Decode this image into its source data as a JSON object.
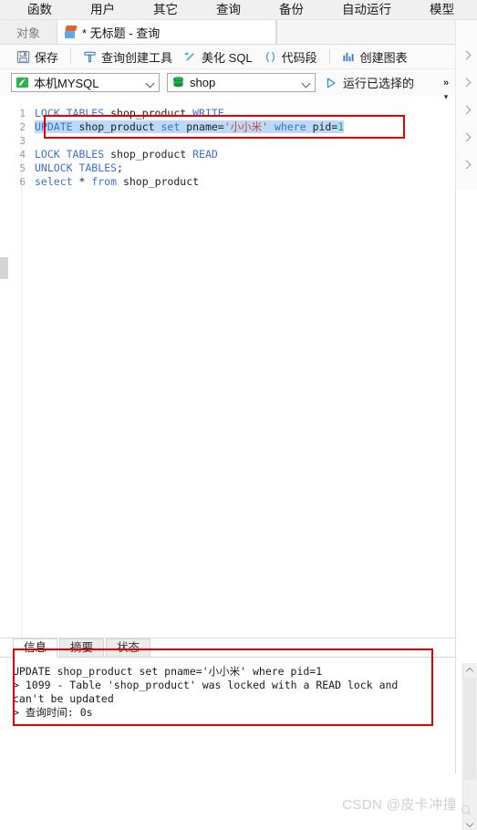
{
  "menubar": {
    "items": [
      {
        "label": "函数"
      },
      {
        "label": "用户"
      },
      {
        "label": "其它"
      },
      {
        "label": "查询"
      },
      {
        "label": "备份"
      },
      {
        "label": "自动运行"
      },
      {
        "label": "模型"
      }
    ]
  },
  "tabstrip": {
    "object_tab": "对象",
    "query_tab": "* 无标题 - 查询"
  },
  "toolbar": {
    "save": "保存",
    "query_builder": "查询创建工具",
    "beautify_sql": "美化 SQL",
    "code_snippet": "代码段",
    "create_chart": "创建图表",
    "connection": "本机MYSQL",
    "database": "shop",
    "run_selected": "运行已选择的",
    "overflow": "»"
  },
  "editor": {
    "lines": [
      {
        "n": "1",
        "tokens": [
          {
            "t": "LOCK TABLES ",
            "c": "kw"
          },
          {
            "t": "shop_product ",
            "c": "id"
          },
          {
            "t": "WRITE",
            "c": "kw"
          }
        ]
      },
      {
        "n": "2",
        "selected": true,
        "tokens": [
          {
            "t": "UPDATE ",
            "c": "kw"
          },
          {
            "t": "shop_product ",
            "c": "id"
          },
          {
            "t": "set ",
            "c": "kw"
          },
          {
            "t": "pname=",
            "c": "id"
          },
          {
            "t": "'小小米'",
            "c": "str"
          },
          {
            "t": " ",
            "c": "id"
          },
          {
            "t": "where ",
            "c": "kw"
          },
          {
            "t": "pid=",
            "c": "id"
          },
          {
            "t": "1",
            "c": "num"
          }
        ]
      },
      {
        "n": "3",
        "tokens": []
      },
      {
        "n": "4",
        "tokens": [
          {
            "t": "LOCK TABLES ",
            "c": "kw"
          },
          {
            "t": "shop_product ",
            "c": "id"
          },
          {
            "t": "READ",
            "c": "kw"
          }
        ]
      },
      {
        "n": "5",
        "tokens": [
          {
            "t": "UNLOCK TABLES",
            "c": "kw"
          },
          {
            "t": ";",
            "c": "op"
          }
        ]
      },
      {
        "n": "6",
        "tokens": [
          {
            "t": "select ",
            "c": "kw"
          },
          {
            "t": "* ",
            "c": "op"
          },
          {
            "t": "from ",
            "c": "kw"
          },
          {
            "t": "shop_product",
            "c": "id"
          }
        ]
      }
    ]
  },
  "results": {
    "tabs": [
      {
        "label": "信息",
        "active": true
      },
      {
        "label": "摘要",
        "active": false
      },
      {
        "label": "状态",
        "active": false
      }
    ],
    "output": [
      "UPDATE shop_product set pname='小小米' where pid=1",
      "> 1099 - Table 'shop_product' was locked with a READ lock and can't be updated",
      "> 查询时间: 0s"
    ]
  },
  "watermark": {
    "text": "CSDN @皮卡冲撞"
  },
  "colors": {
    "annotation_red": "#e60000",
    "keyword_blue": "#3a6fd8",
    "string_red": "#d43a3a",
    "number_green": "#19a36b",
    "selection_blue": "#bcd9f5",
    "accent_blue": "#2a7fd4"
  }
}
